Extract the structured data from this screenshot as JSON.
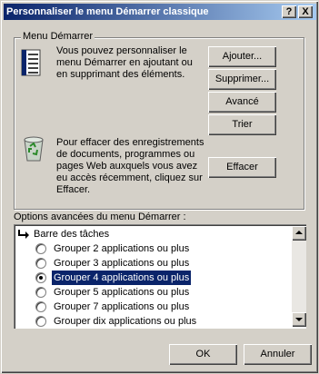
{
  "window": {
    "title": "Personnaliser le menu Démarrer classique",
    "help_button": "?",
    "close_button": "X"
  },
  "menu_group": {
    "title": "Menu Démarrer",
    "customize_text_1": "Vous pouvez personnaliser le",
    "customize_text_2": "menu Démarrer en ajoutant ou",
    "customize_text_3": "en supprimant des éléments.",
    "clear_text_1": "Pour effacer des enregistrements",
    "clear_text_2": "de documents, programmes ou",
    "clear_text_3": "pages Web auxquels vous avez",
    "clear_text_4": "eu accès récemment, cliquez sur",
    "clear_text_5": "Effacer.",
    "buttons": {
      "add": "Ajouter...",
      "remove": "Supprimer...",
      "advanced": "Avancé",
      "sort": "Trier",
      "clear": "Effacer"
    }
  },
  "advanced_options": {
    "label": "Options avancées du menu Démarrer :",
    "taskbar_header": "Barre des tâches",
    "items": [
      {
        "label": "Grouper 2 applications ou plus",
        "selected": false
      },
      {
        "label": "Grouper 3 applications ou plus",
        "selected": false
      },
      {
        "label": "Grouper 4 applications ou plus",
        "selected": true
      },
      {
        "label": "Grouper 5 applications ou plus",
        "selected": false
      },
      {
        "label": "Grouper 7 applications ou plus",
        "selected": false
      },
      {
        "label": "Grouper dix applications ou plus",
        "selected": false
      }
    ]
  },
  "footer": {
    "ok": "OK",
    "cancel": "Annuler"
  },
  "colors": {
    "titlebar_start": "#0a246a",
    "titlebar_end": "#a6caf0",
    "selection": "#0a246a",
    "face": "#d4d0c8"
  }
}
